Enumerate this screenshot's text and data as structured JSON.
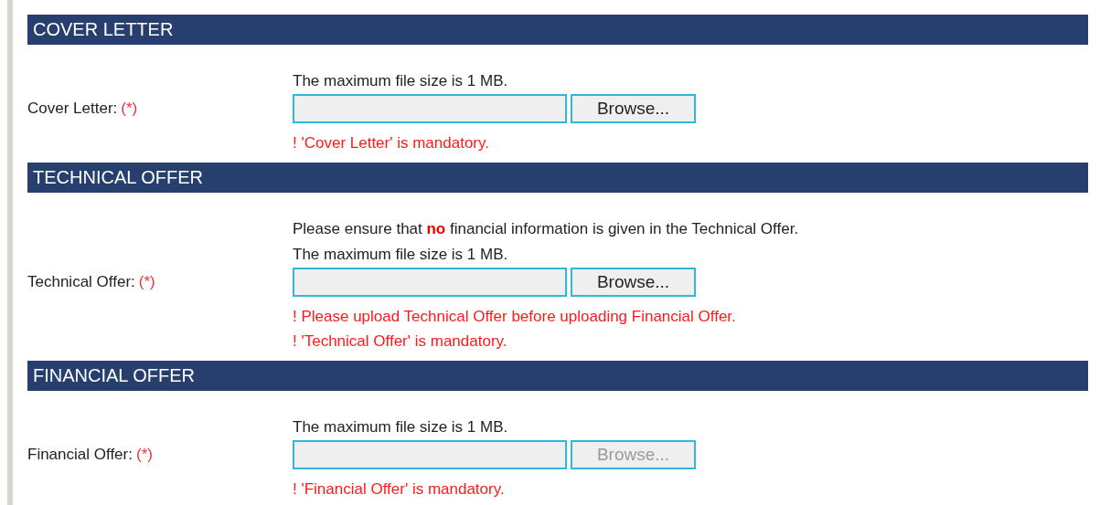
{
  "sections": [
    {
      "title": "COVER LETTER",
      "label": "Cover Letter:",
      "required_mark": "(*)",
      "notes": [
        "The maximum file size is 1 MB."
      ],
      "button": {
        "label": "Browse...",
        "disabled": false
      },
      "errors": [
        "! 'Cover Letter' is mandatory."
      ]
    },
    {
      "title": "TECHNICAL OFFER",
      "label": "Technical Offer:",
      "required_mark": "(*)",
      "notes": [
        "Please ensure that **no** financial information is given in the Technical Offer.",
        "The maximum file size is 1 MB."
      ],
      "button": {
        "label": "Browse...",
        "disabled": false
      },
      "errors": [
        "! Please upload Technical Offer before uploading Financial Offer.",
        "! 'Technical Offer' is mandatory."
      ]
    },
    {
      "title": "FINANCIAL OFFER",
      "label": "Financial Offer:",
      "required_mark": "(*)",
      "notes": [
        "The maximum file size is 1 MB."
      ],
      "button": {
        "label": "Browse...",
        "disabled": true
      },
      "errors": [
        "! 'Financial Offer' is mandatory."
      ]
    }
  ]
}
